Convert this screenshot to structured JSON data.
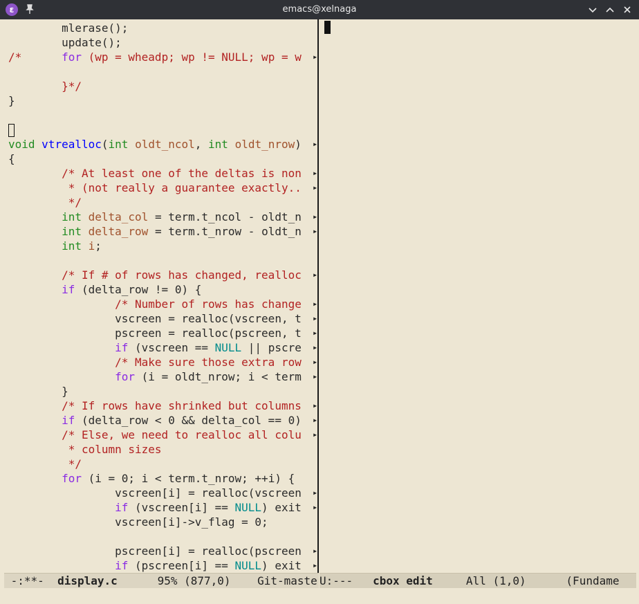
{
  "window": {
    "title": "emacs@xelnaga",
    "app_icon_glyph": "ε"
  },
  "left_pane": {
    "lines": [
      [
        [
          "p",
          "        mlerase();"
        ]
      ],
      [
        [
          "p",
          "        update();"
        ]
      ],
      [
        [
          "c",
          "/*      "
        ],
        [
          "k",
          "for"
        ],
        [
          "c",
          " (wp = wheadp; wp != NULL; wp = w"
        ]
      ],
      [
        [
          "p",
          ""
        ]
      ],
      [
        [
          "c",
          "        }*/"
        ]
      ],
      [
        [
          "p",
          "}"
        ]
      ],
      [
        [
          "p",
          ""
        ]
      ],
      [
        [
          "cursor",
          ""
        ]
      ],
      [
        [
          "t",
          "void"
        ],
        [
          "p",
          " "
        ],
        [
          "f",
          "vtrealloc"
        ],
        [
          "p",
          "("
        ],
        [
          "t",
          "int"
        ],
        [
          "p",
          " "
        ],
        [
          "v",
          "oldt_ncol"
        ],
        [
          "p",
          ", "
        ],
        [
          "t",
          "int"
        ],
        [
          "p",
          " "
        ],
        [
          "v",
          "oldt_nrow"
        ],
        [
          "p",
          ")"
        ]
      ],
      [
        [
          "p",
          "{"
        ]
      ],
      [
        [
          "c",
          "        /* At least one of the deltas is non"
        ]
      ],
      [
        [
          "c",
          "         * (not really a guarantee exactly.."
        ]
      ],
      [
        [
          "c",
          "         */"
        ]
      ],
      [
        [
          "p",
          "        "
        ],
        [
          "t",
          "int"
        ],
        [
          "p",
          " "
        ],
        [
          "v",
          "delta_col"
        ],
        [
          "p",
          " = term.t_ncol - oldt_n"
        ]
      ],
      [
        [
          "p",
          "        "
        ],
        [
          "t",
          "int"
        ],
        [
          "p",
          " "
        ],
        [
          "v",
          "delta_row"
        ],
        [
          "p",
          " = term.t_nrow - oldt_n"
        ]
      ],
      [
        [
          "p",
          "        "
        ],
        [
          "t",
          "int"
        ],
        [
          "p",
          " "
        ],
        [
          "v",
          "i"
        ],
        [
          "p",
          ";"
        ]
      ],
      [
        [
          "p",
          ""
        ]
      ],
      [
        [
          "c",
          "        /* If # of rows has changed, realloc"
        ]
      ],
      [
        [
          "p",
          "        "
        ],
        [
          "k",
          "if"
        ],
        [
          "p",
          " (delta_row != 0) {"
        ]
      ],
      [
        [
          "c",
          "                /* Number of rows has change"
        ]
      ],
      [
        [
          "p",
          "                vscreen = realloc(vscreen, t"
        ]
      ],
      [
        [
          "p",
          "                pscreen = realloc(pscreen, t"
        ]
      ],
      [
        [
          "p",
          "                "
        ],
        [
          "k",
          "if"
        ],
        [
          "p",
          " (vscreen == "
        ],
        [
          "n",
          "NULL"
        ],
        [
          "p",
          " || pscre"
        ]
      ],
      [
        [
          "c",
          "                /* Make sure those extra row"
        ]
      ],
      [
        [
          "p",
          "                "
        ],
        [
          "k",
          "for"
        ],
        [
          "p",
          " (i = oldt_nrow; i < term"
        ]
      ],
      [
        [
          "p",
          "        }"
        ]
      ],
      [
        [
          "c",
          "        /* If rows have shrinked but columns"
        ]
      ],
      [
        [
          "p",
          "        "
        ],
        [
          "k",
          "if"
        ],
        [
          "p",
          " (delta_row < 0 && delta_col == 0)"
        ]
      ],
      [
        [
          "c",
          "        /* Else, we need to realloc all colu"
        ]
      ],
      [
        [
          "c",
          "         * column sizes"
        ]
      ],
      [
        [
          "c",
          "         */"
        ]
      ],
      [
        [
          "p",
          "        "
        ],
        [
          "k",
          "for"
        ],
        [
          "p",
          " (i = 0; i < term.t_nrow; ++i) {"
        ]
      ],
      [
        [
          "p",
          "                vscreen[i] = realloc(vscreen"
        ]
      ],
      [
        [
          "p",
          "                "
        ],
        [
          "k",
          "if"
        ],
        [
          "p",
          " (vscreen[i] == "
        ],
        [
          "n",
          "NULL"
        ],
        [
          "p",
          ") exit"
        ]
      ],
      [
        [
          "p",
          "                vscreen[i]->v_flag = 0;"
        ]
      ],
      [
        [
          "p",
          ""
        ]
      ],
      [
        [
          "p",
          "                pscreen[i] = realloc(pscreen"
        ]
      ],
      [
        [
          "p",
          "                "
        ],
        [
          "k",
          "if"
        ],
        [
          "p",
          " (pscreen[i] == "
        ],
        [
          "n",
          "NULL"
        ],
        [
          "p",
          ") exit"
        ]
      ]
    ],
    "truncated_rows": [
      2,
      8,
      10,
      11,
      13,
      14,
      17,
      19,
      20,
      21,
      22,
      23,
      24,
      26,
      27,
      28,
      32,
      33,
      36,
      37
    ],
    "truncation_glyph": "▸"
  },
  "modeline_left": {
    "status": " -:**-  ",
    "buffer": "display.c",
    "position": "      95% (877,0)    ",
    "vc": "Git-maste"
  },
  "modeline_right": {
    "status": "U:---   ",
    "buffer": "cbox edit",
    "position": "     All (1,0)      ",
    "mode": "(Fundame"
  },
  "colors": {
    "background": "#ede6d3",
    "comment": "#b22222",
    "keyword": "#8a2be2",
    "type": "#228b22",
    "function": "#0000ff",
    "variable": "#a0522d",
    "constant": "#008b8b"
  }
}
